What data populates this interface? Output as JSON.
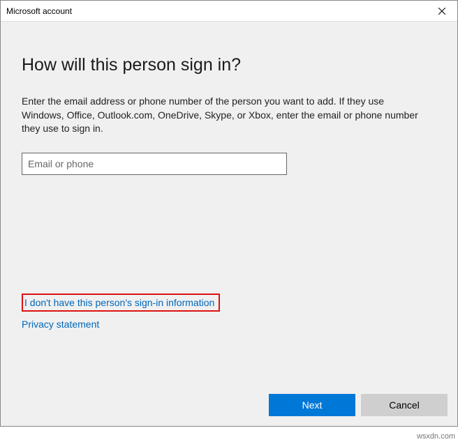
{
  "titlebar": {
    "title": "Microsoft account"
  },
  "main": {
    "heading": "How will this person sign in?",
    "description": "Enter the email address or phone number of the person you want to add. If they use Windows, Office, Outlook.com, OneDrive, Skype, or Xbox, enter the email or phone number they use to sign in.",
    "input_placeholder": "Email or phone"
  },
  "links": {
    "no_info": "I don't have this person's sign-in information",
    "privacy": "Privacy statement"
  },
  "footer": {
    "next": "Next",
    "cancel": "Cancel"
  },
  "watermark": "wsxdn.com"
}
